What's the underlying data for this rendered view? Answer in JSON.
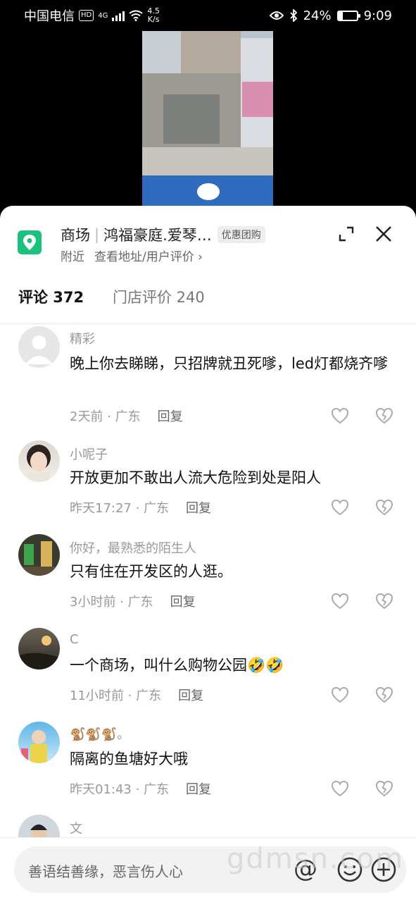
{
  "status_bar": {
    "carrier": "中国电信",
    "hd": "HD",
    "network": "4G",
    "speed_value": "4.5",
    "speed_unit": "K/s",
    "battery": "24%",
    "battery_level": 0.24,
    "time": "9:09"
  },
  "poi": {
    "category": "商场",
    "name": "鸿福豪庭.爱琴…",
    "deal_tag": "优惠团购",
    "nearby": "附近",
    "address_link": "查看地址/用户评价 ›"
  },
  "tabs": [
    {
      "label": "评论 372"
    },
    {
      "label": "门店评价 240"
    }
  ],
  "comments": [
    {
      "user": "精彩",
      "text": "晚上你去睇睇，只招牌就丑死嗲，led灯都烧齐嗲",
      "time": "2天前",
      "location": "广东",
      "reply": "回复"
    },
    {
      "user": "小呢子",
      "text": "开放更加不敢出人流大危险到处是阳人",
      "time": "昨天17:27",
      "location": "广东",
      "reply": "回复"
    },
    {
      "user": "你好，最熟悉的陌生人",
      "text": "只有住在开发区的人逛。",
      "time": "3小时前",
      "location": "广东",
      "reply": "回复"
    },
    {
      "user": "C",
      "text": "一个商场，叫什么购物公园🤣🤣",
      "time": "11小时前",
      "location": "广东",
      "reply": "回复"
    },
    {
      "user": "🐒🐒🐒。",
      "text": "隔离的鱼塘好大哦",
      "time": "昨天01:43",
      "location": "广东",
      "reply": "回复"
    },
    {
      "user": "文",
      "text": "",
      "time": "",
      "location": "",
      "reply": ""
    }
  ],
  "meta_separator": " · ",
  "input": {
    "placeholder": "善语结善缘，恶言伤人心",
    "at_symbol": "@"
  },
  "watermark": "gdmsn.com",
  "colors": {
    "accent_green": "#19c37d",
    "text_primary": "#111111",
    "text_secondary": "#999999"
  }
}
